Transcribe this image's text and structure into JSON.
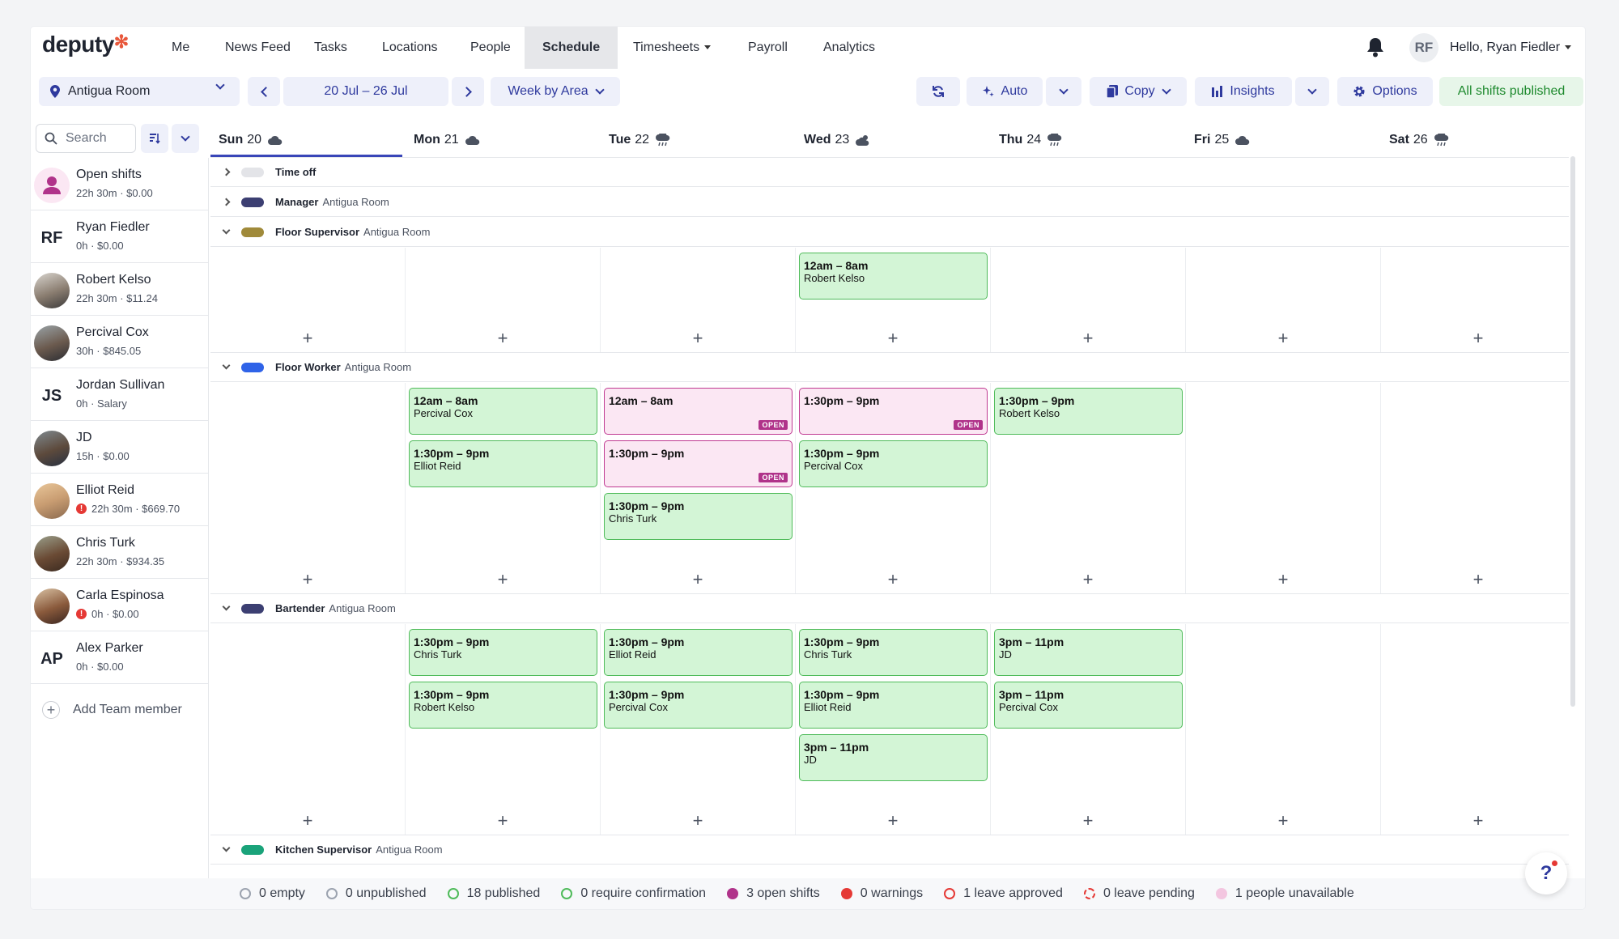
{
  "app": {
    "logo": "deputy"
  },
  "nav": {
    "items": [
      {
        "label": "Me"
      },
      {
        "label": "News Feed"
      },
      {
        "label": "Tasks"
      },
      {
        "label": "Locations"
      },
      {
        "label": "People"
      },
      {
        "label": "Schedule"
      },
      {
        "label": "Timesheets"
      },
      {
        "label": "Payroll"
      },
      {
        "label": "Analytics"
      }
    ],
    "active": "Schedule",
    "user_initials": "RF",
    "greeting": "Hello, Ryan Fiedler"
  },
  "toolbar": {
    "location": "Antigua Room",
    "date_range": "20 Jul – 26 Jul",
    "view": "Week by Area",
    "auto_label": "Auto",
    "copy_label": "Copy",
    "insights_label": "Insights",
    "options_label": "Options",
    "status_label": "All shifts published"
  },
  "sidebar": {
    "search_placeholder": "Search",
    "people": [
      {
        "name": "Open shifts",
        "meta": "22h 30m · $0.00",
        "initials": "",
        "warning": false
      },
      {
        "name": "Ryan Fiedler",
        "meta": "0h · $0.00",
        "initials": "RF",
        "warning": false
      },
      {
        "name": "Robert Kelso",
        "meta": "22h 30m · $11.24",
        "initials": "",
        "warning": false
      },
      {
        "name": "Percival Cox",
        "meta": "30h · $845.05",
        "initials": "",
        "warning": false
      },
      {
        "name": "Jordan Sullivan",
        "meta": "0h · Salary",
        "initials": "JS",
        "warning": false
      },
      {
        "name": "JD",
        "meta": "15h · $0.00",
        "initials": "",
        "warning": false
      },
      {
        "name": "Elliot Reid",
        "meta": "22h 30m · $669.70",
        "initials": "",
        "warning": true
      },
      {
        "name": "Chris Turk",
        "meta": "22h 30m · $934.35",
        "initials": "",
        "warning": false
      },
      {
        "name": "Carla Espinosa",
        "meta": "0h · $0.00",
        "initials": "",
        "warning": true
      },
      {
        "name": "Alex Parker",
        "meta": "0h · $0.00",
        "initials": "AP",
        "warning": false
      }
    ],
    "add_member_label": "Add Team member"
  },
  "days": [
    {
      "name": "Sun",
      "num": "20"
    },
    {
      "name": "Mon",
      "num": "21"
    },
    {
      "name": "Tue",
      "num": "22"
    },
    {
      "name": "Wed",
      "num": "23"
    },
    {
      "name": "Thu",
      "num": "24"
    },
    {
      "name": "Fri",
      "num": "25"
    },
    {
      "name": "Sat",
      "num": "26"
    }
  ],
  "areas": {
    "time_off": {
      "name": "Time off",
      "location": "",
      "color": "#e3e4e8"
    },
    "manager": {
      "name": "Manager",
      "location": "Antigua Room",
      "color": "#3c3f72"
    },
    "floor_supervisor": {
      "name": "Floor Supervisor",
      "location": "Antigua Room",
      "color": "#a08a3a"
    },
    "floor_worker": {
      "name": "Floor Worker",
      "location": "Antigua Room",
      "color": "#2f63e8"
    },
    "bartender": {
      "name": "Bartender",
      "location": "Antigua Room",
      "color": "#3c3f72"
    },
    "kitchen_supervisor": {
      "name": "Kitchen Supervisor",
      "location": "Antigua Room",
      "color": "#1aa37a"
    }
  },
  "shifts": {
    "floor_supervisor": [
      {
        "day": 3,
        "slot": 0,
        "time": "12am – 8am",
        "name": "Robert Kelso",
        "open": false
      }
    ],
    "floor_worker": [
      {
        "day": 1,
        "slot": 0,
        "time": "12am – 8am",
        "name": "Percival Cox",
        "open": false
      },
      {
        "day": 1,
        "slot": 1,
        "time": "1:30pm – 9pm",
        "name": "Elliot Reid",
        "open": false
      },
      {
        "day": 2,
        "slot": 0,
        "time": "12am – 8am",
        "name": "",
        "open": true
      },
      {
        "day": 2,
        "slot": 1,
        "time": "1:30pm – 9pm",
        "name": "",
        "open": true
      },
      {
        "day": 2,
        "slot": 2,
        "time": "1:30pm – 9pm",
        "name": "Chris Turk",
        "open": false
      },
      {
        "day": 3,
        "slot": 0,
        "time": "1:30pm – 9pm",
        "name": "",
        "open": true
      },
      {
        "day": 3,
        "slot": 1,
        "time": "1:30pm – 9pm",
        "name": "Percival Cox",
        "open": false
      },
      {
        "day": 4,
        "slot": 0,
        "time": "1:30pm – 9pm",
        "name": "Robert Kelso",
        "open": false
      }
    ],
    "bartender": [
      {
        "day": 1,
        "slot": 0,
        "time": "1:30pm – 9pm",
        "name": "Chris Turk",
        "open": false
      },
      {
        "day": 1,
        "slot": 1,
        "time": "1:30pm – 9pm",
        "name": "Robert Kelso",
        "open": false
      },
      {
        "day": 2,
        "slot": 0,
        "time": "1:30pm – 9pm",
        "name": "Elliot Reid",
        "open": false
      },
      {
        "day": 2,
        "slot": 1,
        "time": "1:30pm – 9pm",
        "name": "Percival Cox",
        "open": false
      },
      {
        "day": 3,
        "slot": 0,
        "time": "1:30pm – 9pm",
        "name": "Chris Turk",
        "open": false
      },
      {
        "day": 3,
        "slot": 1,
        "time": "1:30pm – 9pm",
        "name": "Elliot Reid",
        "open": false
      },
      {
        "day": 3,
        "slot": 2,
        "time": "3pm – 11pm",
        "name": "JD",
        "open": false
      },
      {
        "day": 4,
        "slot": 0,
        "time": "3pm – 11pm",
        "name": "JD",
        "open": false
      },
      {
        "day": 4,
        "slot": 1,
        "time": "3pm – 11pm",
        "name": "Percival Cox",
        "open": false
      }
    ]
  },
  "open_badge": "OPEN",
  "legend": [
    {
      "label": "0 empty",
      "color": "#9ca3af",
      "style": "ring"
    },
    {
      "label": "0 unpublished",
      "color": "#9ca3af",
      "style": "ring"
    },
    {
      "label": "18 published",
      "color": "#4fbb5a",
      "style": "ring"
    },
    {
      "label": "0 require confirmation",
      "color": "#4fbb5a",
      "style": "ring"
    },
    {
      "label": "3 open shifts",
      "color": "#b0338a",
      "style": "solid"
    },
    {
      "label": "0 warnings",
      "color": "#e53935",
      "style": "solid"
    },
    {
      "label": "1 leave approved",
      "color": "#e53935",
      "style": "ring"
    },
    {
      "label": "0 leave pending",
      "color": "#e53935",
      "style": "dashed"
    },
    {
      "label": "1 people unavailable",
      "color": "#f3c6e0",
      "style": "solid"
    }
  ],
  "help_label": "?"
}
